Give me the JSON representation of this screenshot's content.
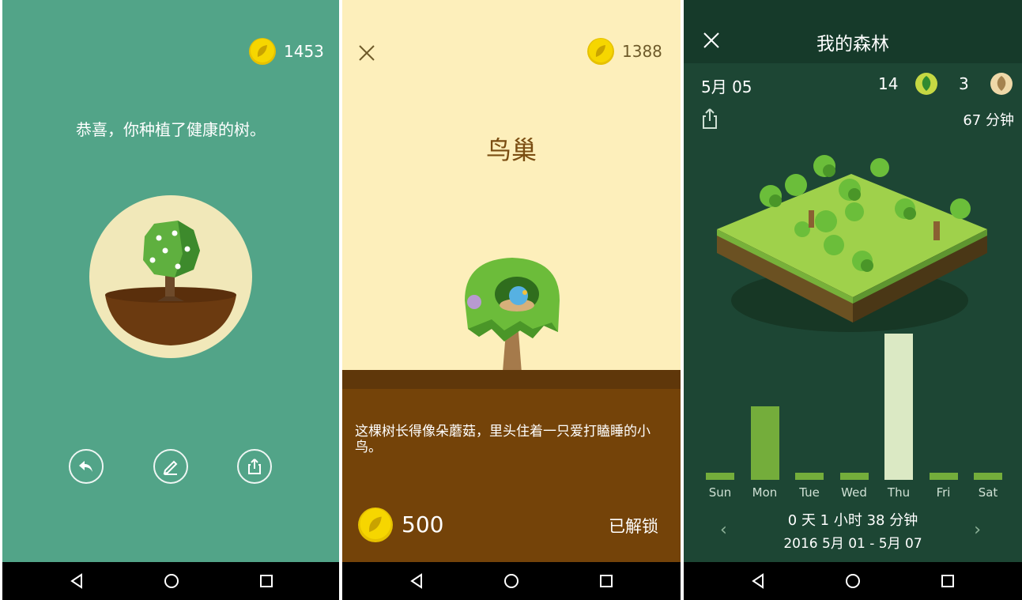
{
  "screen1": {
    "coins": "1453",
    "message": "恭喜，你种植了健康的树。",
    "buttons": [
      {
        "icon": "undo-icon"
      },
      {
        "icon": "edit-icon"
      },
      {
        "icon": "share-icon"
      }
    ]
  },
  "screen2": {
    "coins": "1388",
    "title": "鸟巢",
    "description": "这棵树长得像朵蘑菇，里头住着一只爱打瞌睡的小鸟。",
    "price": "500",
    "status": "已解锁"
  },
  "screen3": {
    "title": "我的森林",
    "date": "5月 05",
    "healthy_count": "14",
    "dead_count": "3",
    "total_minutes": "67 分钟",
    "summary": "0 天 1 小时 38 分钟",
    "range": "2016 5月 01 - 5月 07",
    "prev": "‹",
    "next": "›",
    "chart_data": {
      "type": "bar",
      "categories": [
        "Sun",
        "Mon",
        "Tue",
        "Wed",
        "Thu",
        "Fri",
        "Sat"
      ],
      "values": [
        0.05,
        0.5,
        0.05,
        0.05,
        1.0,
        0.05,
        0.05
      ],
      "ylabel": "",
      "xlabel": "",
      "colors": {
        "normal": "#74ad3b",
        "highlight": "#dbe9c4"
      },
      "highlight_index": 4
    }
  },
  "colors": {
    "panel1_bg": "#52a488",
    "panel2_bg": "#fdefbb",
    "panel3_bg": "#1d4634",
    "coin": "#f6d200"
  }
}
